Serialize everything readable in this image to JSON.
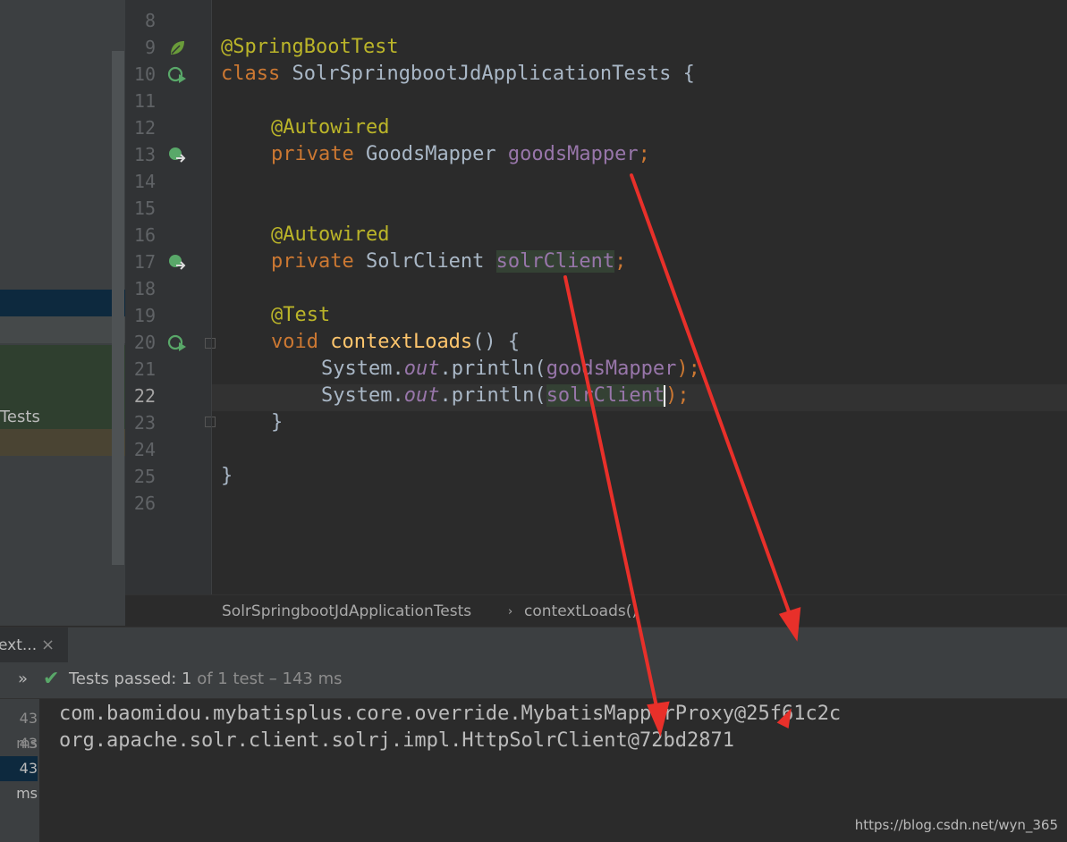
{
  "left_panel": {
    "tests_label": "Tests"
  },
  "editor": {
    "lines": [
      {
        "n": "8"
      },
      {
        "n": "9"
      },
      {
        "n": "10"
      },
      {
        "n": "11"
      },
      {
        "n": "12"
      },
      {
        "n": "13"
      },
      {
        "n": "14"
      },
      {
        "n": "15"
      },
      {
        "n": "16"
      },
      {
        "n": "17"
      },
      {
        "n": "18"
      },
      {
        "n": "19"
      },
      {
        "n": "20"
      },
      {
        "n": "21"
      },
      {
        "n": "22"
      },
      {
        "n": "23"
      },
      {
        "n": "24"
      },
      {
        "n": "25"
      },
      {
        "n": "26"
      }
    ],
    "code": {
      "l9_ann": "@SpringBootTest",
      "l10_kw": "class",
      "l10_name": "SolrSpringbootJdApplicationTests {",
      "l12_ann": "@Autowired",
      "l13_kw": "private",
      "l13_type": "GoodsMapper",
      "l13_field": "goodsMapper",
      "l13_semi": ";",
      "l16_ann": "@Autowired",
      "l17_kw": "private",
      "l17_type": "SolrClient",
      "l17_field": "solrClient",
      "l17_semi": ";",
      "l19_ann": "@Test",
      "l20_kw": "void",
      "l20_method": "contextLoads",
      "l20_rest": "() {",
      "l21_sys": "System.",
      "l21_out": "out",
      "l21_print": ".println(",
      "l21_arg": "goodsMapper",
      "l21_end": ");",
      "l22_sys": "System.",
      "l22_out": "out",
      "l22_print": ".println(",
      "l22_arg": "solrClient",
      "l22_end": ");",
      "l23_close": "}",
      "l25_close": "}"
    },
    "gutter_icons": [
      "spring-bean-icon",
      "run-test-class-icon",
      "autowired-bean-icon",
      "autowired-bean-icon",
      "run-test-method-icon"
    ]
  },
  "breadcrumb": {
    "class_name": "SolrSpringbootJdApplicationTests",
    "separator": "›",
    "method_name": "contextLoads()"
  },
  "run_panel": {
    "tab_label": "ext...",
    "close_glyph": "×",
    "chevron_glyph": "»",
    "check_glyph": "✔",
    "status_prefix": "Tests passed: ",
    "status_count": "1",
    "status_of": " of 1 test",
    "status_time": " – 143 ms",
    "left_times": [
      "43 ms",
      "43 ms",
      "43 ms"
    ],
    "console_lines": [
      "com.baomidou.mybatisplus.core.override.MybatisMapperProxy@25f61c2c",
      "org.apache.solr.client.solrj.impl.HttpSolrClient@72bd2871"
    ]
  },
  "watermark": "https://blog.csdn.net/wyn_365",
  "colors": {
    "annotation": "#bbb529",
    "keyword": "#cc7832",
    "field": "#9876aa",
    "method": "#ffc66d",
    "pass_green": "#59a869",
    "arrow_red": "#e8302a"
  }
}
